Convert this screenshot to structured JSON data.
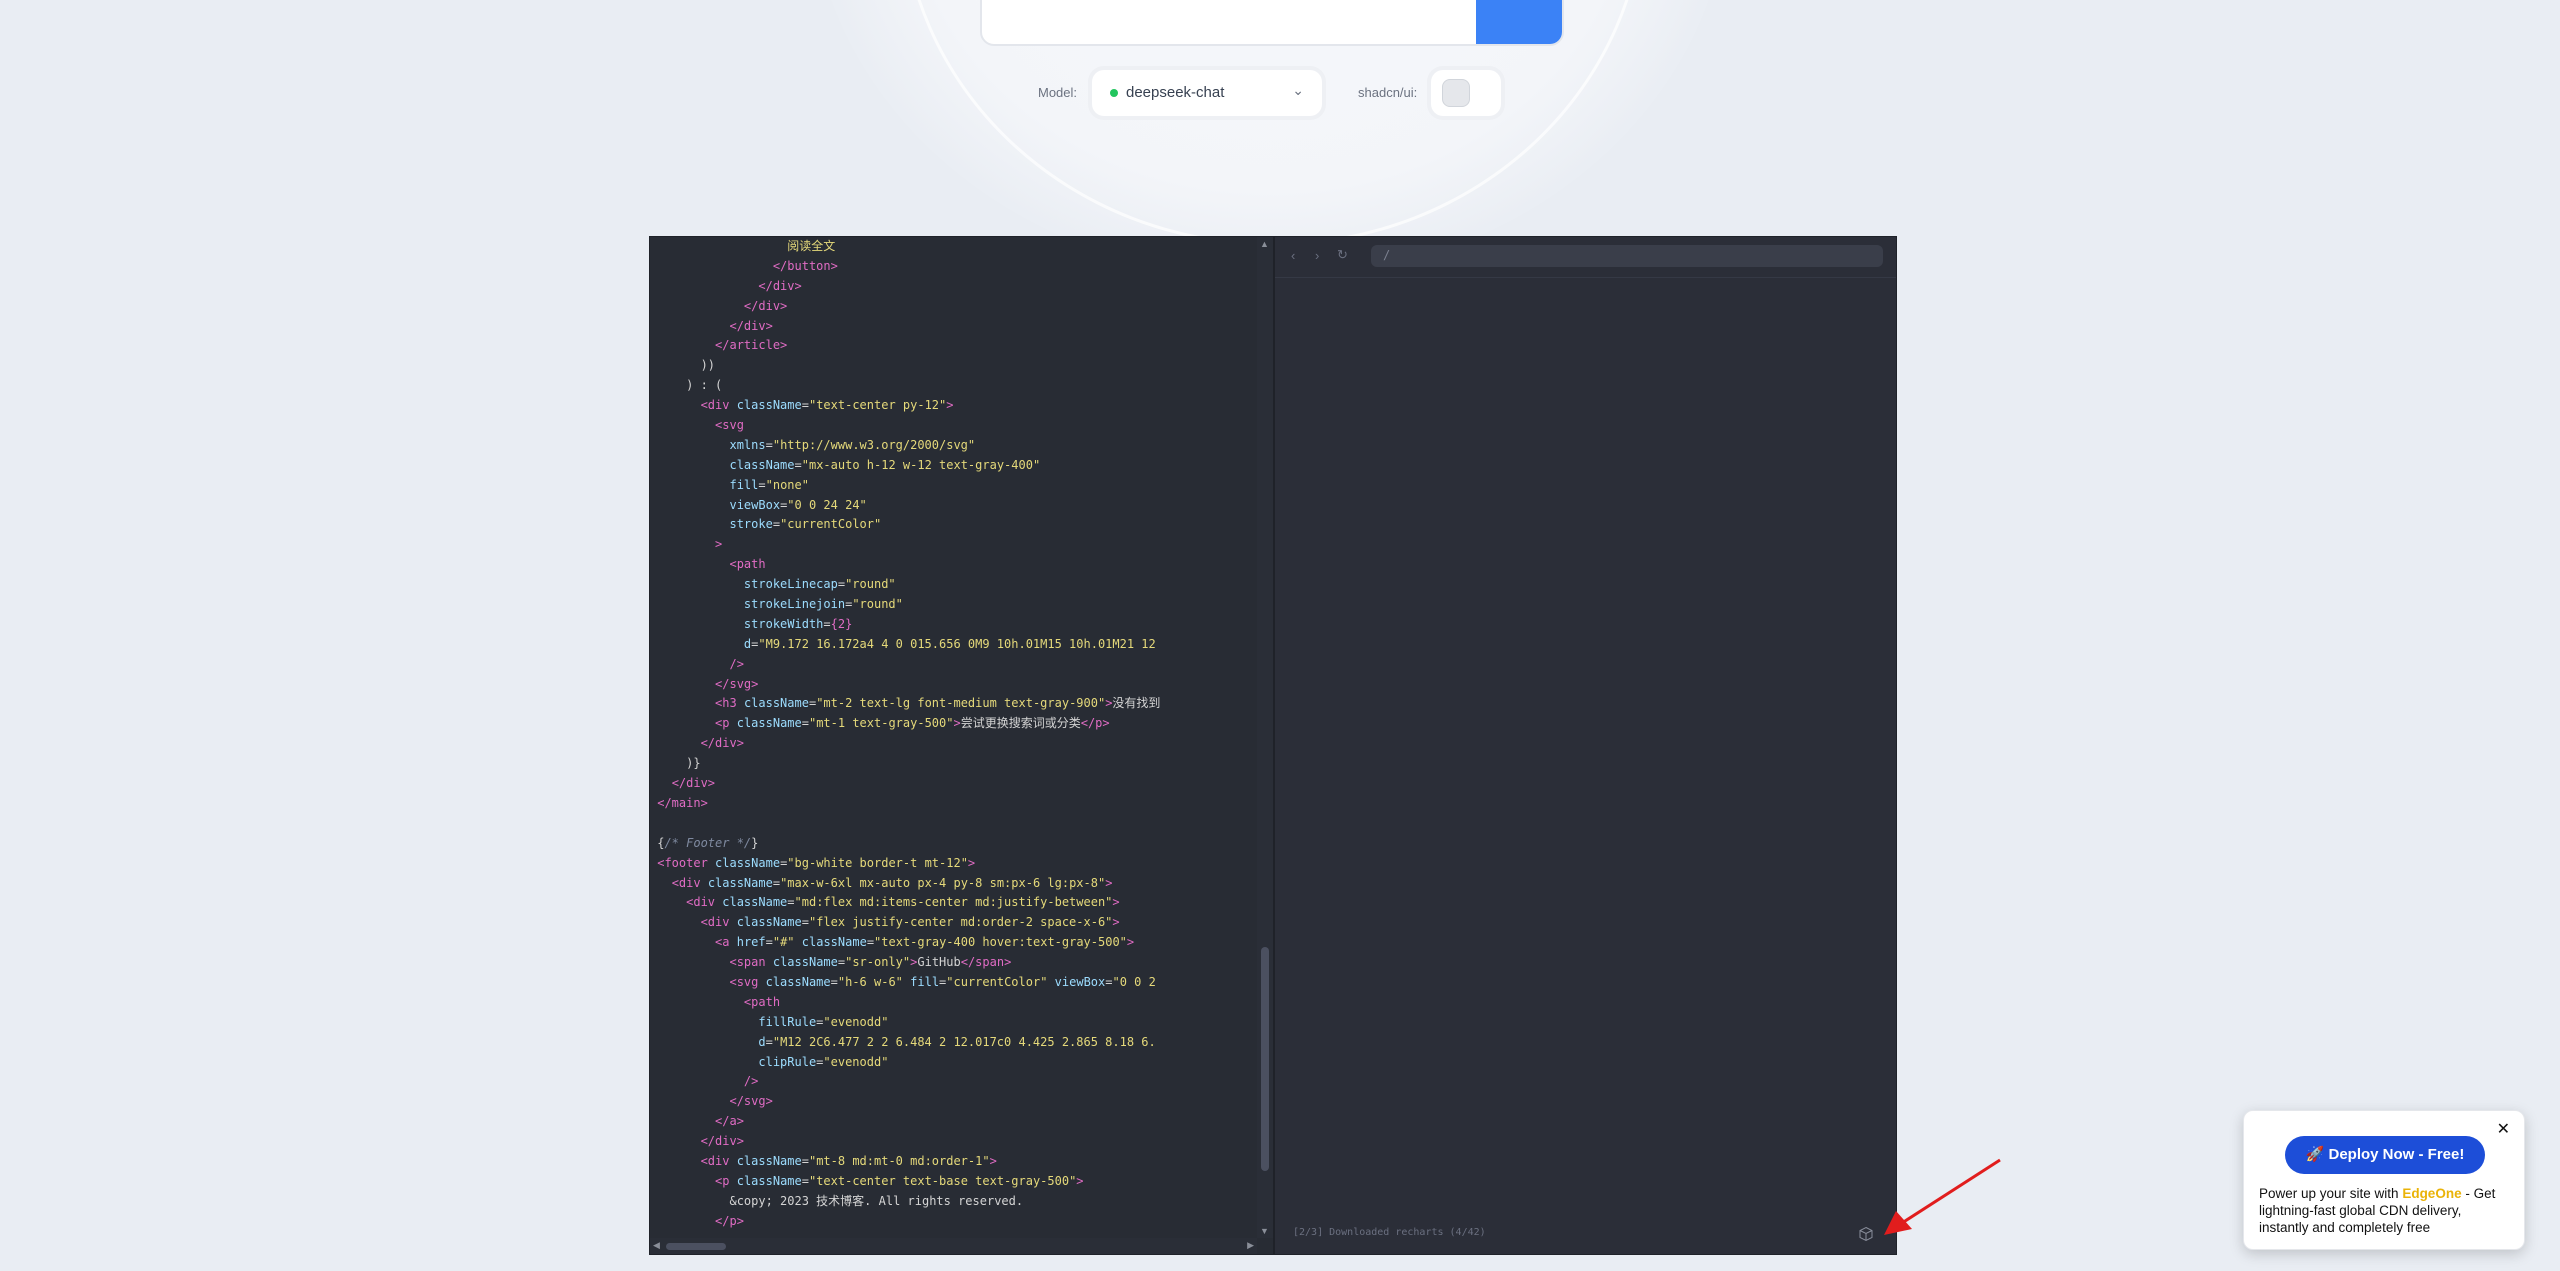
{
  "controls": {
    "model_label": "Model:",
    "model_value": "deepseek-chat",
    "shadcn_label": "shadcn/ui:"
  },
  "code_lines": [
    {
      "segs": [
        {
          "c": "s",
          "t": "                   阅读全文"
        }
      ]
    },
    {
      "segs": [
        {
          "c": "p",
          "t": "                 "
        },
        {
          "c": "t",
          "t": "</button>"
        }
      ]
    },
    {
      "segs": [
        {
          "c": "p",
          "t": "               "
        },
        {
          "c": "t",
          "t": "</div>"
        }
      ]
    },
    {
      "segs": [
        {
          "c": "p",
          "t": "             "
        },
        {
          "c": "t",
          "t": "</div>"
        }
      ]
    },
    {
      "segs": [
        {
          "c": "p",
          "t": "           "
        },
        {
          "c": "t",
          "t": "</div>"
        }
      ]
    },
    {
      "segs": [
        {
          "c": "p",
          "t": "         "
        },
        {
          "c": "t",
          "t": "</article>"
        }
      ]
    },
    {
      "segs": [
        {
          "c": "p",
          "t": "       ))"
        }
      ]
    },
    {
      "segs": [
        {
          "c": "p",
          "t": "     ) : ("
        }
      ]
    },
    {
      "segs": [
        {
          "c": "p",
          "t": "       "
        },
        {
          "c": "t",
          "t": "<div "
        },
        {
          "c": "a",
          "t": "className"
        },
        {
          "c": "p",
          "t": "="
        },
        {
          "c": "s",
          "t": "\"text-center py-12\""
        },
        {
          "c": "t",
          "t": ">"
        }
      ]
    },
    {
      "segs": [
        {
          "c": "p",
          "t": "         "
        },
        {
          "c": "t",
          "t": "<svg"
        }
      ]
    },
    {
      "segs": [
        {
          "c": "p",
          "t": "           "
        },
        {
          "c": "a",
          "t": "xmlns"
        },
        {
          "c": "p",
          "t": "="
        },
        {
          "c": "s",
          "t": "\"http://www.w3.org/2000/svg\""
        }
      ]
    },
    {
      "segs": [
        {
          "c": "p",
          "t": "           "
        },
        {
          "c": "a",
          "t": "className"
        },
        {
          "c": "p",
          "t": "="
        },
        {
          "c": "s",
          "t": "\"mx-auto h-12 w-12 text-gray-400\""
        }
      ]
    },
    {
      "segs": [
        {
          "c": "p",
          "t": "           "
        },
        {
          "c": "a",
          "t": "fill"
        },
        {
          "c": "p",
          "t": "="
        },
        {
          "c": "s",
          "t": "\"none\""
        }
      ]
    },
    {
      "segs": [
        {
          "c": "p",
          "t": "           "
        },
        {
          "c": "a",
          "t": "viewBox"
        },
        {
          "c": "p",
          "t": "="
        },
        {
          "c": "s",
          "t": "\"0 0 24 24\""
        }
      ]
    },
    {
      "segs": [
        {
          "c": "p",
          "t": "           "
        },
        {
          "c": "a",
          "t": "stroke"
        },
        {
          "c": "p",
          "t": "="
        },
        {
          "c": "s",
          "t": "\"currentColor\""
        }
      ]
    },
    {
      "segs": [
        {
          "c": "p",
          "t": "         "
        },
        {
          "c": "t",
          "t": ">"
        }
      ]
    },
    {
      "segs": [
        {
          "c": "p",
          "t": "           "
        },
        {
          "c": "t",
          "t": "<path"
        }
      ]
    },
    {
      "segs": [
        {
          "c": "p",
          "t": "             "
        },
        {
          "c": "a",
          "t": "strokeLinecap"
        },
        {
          "c": "p",
          "t": "="
        },
        {
          "c": "s",
          "t": "\"round\""
        }
      ]
    },
    {
      "segs": [
        {
          "c": "p",
          "t": "             "
        },
        {
          "c": "a",
          "t": "strokeLinejoin"
        },
        {
          "c": "p",
          "t": "="
        },
        {
          "c": "s",
          "t": "\"round\""
        }
      ]
    },
    {
      "segs": [
        {
          "c": "p",
          "t": "             "
        },
        {
          "c": "a",
          "t": "strokeWidth"
        },
        {
          "c": "p",
          "t": "="
        },
        {
          "c": "t",
          "t": "{2}"
        }
      ]
    },
    {
      "segs": [
        {
          "c": "p",
          "t": "             "
        },
        {
          "c": "a",
          "t": "d"
        },
        {
          "c": "p",
          "t": "="
        },
        {
          "c": "s",
          "t": "\"M9.172 16.172a4 4 0 015.656 0M9 10h.01M15 10h.01M21 12"
        }
      ]
    },
    {
      "segs": [
        {
          "c": "p",
          "t": "           "
        },
        {
          "c": "t",
          "t": "/>"
        }
      ]
    },
    {
      "segs": [
        {
          "c": "p",
          "t": "         "
        },
        {
          "c": "t",
          "t": "</svg>"
        }
      ]
    },
    {
      "segs": [
        {
          "c": "p",
          "t": "         "
        },
        {
          "c": "t",
          "t": "<h3 "
        },
        {
          "c": "a",
          "t": "className"
        },
        {
          "c": "p",
          "t": "="
        },
        {
          "c": "s",
          "t": "\"mt-2 text-lg font-medium text-gray-900\""
        },
        {
          "c": "t",
          "t": ">"
        },
        {
          "c": "p",
          "t": "没有找到"
        }
      ]
    },
    {
      "segs": [
        {
          "c": "p",
          "t": "         "
        },
        {
          "c": "t",
          "t": "<p "
        },
        {
          "c": "a",
          "t": "className"
        },
        {
          "c": "p",
          "t": "="
        },
        {
          "c": "s",
          "t": "\"mt-1 text-gray-500\""
        },
        {
          "c": "t",
          "t": ">"
        },
        {
          "c": "p",
          "t": "尝试更换搜索词或分类"
        },
        {
          "c": "t",
          "t": "</p>"
        }
      ]
    },
    {
      "segs": [
        {
          "c": "p",
          "t": "       "
        },
        {
          "c": "t",
          "t": "</div>"
        }
      ]
    },
    {
      "segs": [
        {
          "c": "p",
          "t": "     )}"
        }
      ]
    },
    {
      "segs": [
        {
          "c": "p",
          "t": "   "
        },
        {
          "c": "t",
          "t": "</div>"
        }
      ]
    },
    {
      "segs": [
        {
          "c": "p",
          "t": " "
        },
        {
          "c": "t",
          "t": "</main>"
        }
      ]
    },
    {
      "segs": [
        {
          "c": "p",
          "t": ""
        }
      ]
    },
    {
      "segs": [
        {
          "c": "p",
          "t": " {"
        },
        {
          "c": "c",
          "t": "/* Footer */"
        },
        {
          "c": "p",
          "t": "}"
        }
      ]
    },
    {
      "segs": [
        {
          "c": "p",
          "t": " "
        },
        {
          "c": "t",
          "t": "<footer "
        },
        {
          "c": "a",
          "t": "className"
        },
        {
          "c": "p",
          "t": "="
        },
        {
          "c": "s",
          "t": "\"bg-white border-t mt-12\""
        },
        {
          "c": "t",
          "t": ">"
        }
      ]
    },
    {
      "segs": [
        {
          "c": "p",
          "t": "   "
        },
        {
          "c": "t",
          "t": "<div "
        },
        {
          "c": "a",
          "t": "className"
        },
        {
          "c": "p",
          "t": "="
        },
        {
          "c": "s",
          "t": "\"max-w-6xl mx-auto px-4 py-8 sm:px-6 lg:px-8\""
        },
        {
          "c": "t",
          "t": ">"
        }
      ]
    },
    {
      "segs": [
        {
          "c": "p",
          "t": "     "
        },
        {
          "c": "t",
          "t": "<div "
        },
        {
          "c": "a",
          "t": "className"
        },
        {
          "c": "p",
          "t": "="
        },
        {
          "c": "s",
          "t": "\"md:flex md:items-center md:justify-between\""
        },
        {
          "c": "t",
          "t": ">"
        }
      ]
    },
    {
      "segs": [
        {
          "c": "p",
          "t": "       "
        },
        {
          "c": "t",
          "t": "<div "
        },
        {
          "c": "a",
          "t": "className"
        },
        {
          "c": "p",
          "t": "="
        },
        {
          "c": "s",
          "t": "\"flex justify-center md:order-2 space-x-6\""
        },
        {
          "c": "t",
          "t": ">"
        }
      ]
    },
    {
      "segs": [
        {
          "c": "p",
          "t": "         "
        },
        {
          "c": "t",
          "t": "<a "
        },
        {
          "c": "a",
          "t": "href"
        },
        {
          "c": "p",
          "t": "="
        },
        {
          "c": "s",
          "t": "\"#\""
        },
        {
          "c": "p",
          "t": " "
        },
        {
          "c": "a",
          "t": "className"
        },
        {
          "c": "p",
          "t": "="
        },
        {
          "c": "s",
          "t": "\"text-gray-400 hover:text-gray-500\""
        },
        {
          "c": "t",
          "t": ">"
        }
      ]
    },
    {
      "segs": [
        {
          "c": "p",
          "t": "           "
        },
        {
          "c": "t",
          "t": "<span "
        },
        {
          "c": "a",
          "t": "className"
        },
        {
          "c": "p",
          "t": "="
        },
        {
          "c": "s",
          "t": "\"sr-only\""
        },
        {
          "c": "t",
          "t": ">"
        },
        {
          "c": "p",
          "t": "GitHub"
        },
        {
          "c": "t",
          "t": "</span>"
        }
      ]
    },
    {
      "segs": [
        {
          "c": "p",
          "t": "           "
        },
        {
          "c": "t",
          "t": "<svg "
        },
        {
          "c": "a",
          "t": "className"
        },
        {
          "c": "p",
          "t": "="
        },
        {
          "c": "s",
          "t": "\"h-6 w-6\""
        },
        {
          "c": "p",
          "t": " "
        },
        {
          "c": "a",
          "t": "fill"
        },
        {
          "c": "p",
          "t": "="
        },
        {
          "c": "s",
          "t": "\"currentColor\""
        },
        {
          "c": "p",
          "t": " "
        },
        {
          "c": "a",
          "t": "viewBox"
        },
        {
          "c": "p",
          "t": "="
        },
        {
          "c": "s",
          "t": "\"0 0 2"
        }
      ]
    },
    {
      "segs": [
        {
          "c": "p",
          "t": "             "
        },
        {
          "c": "t",
          "t": "<path"
        }
      ]
    },
    {
      "segs": [
        {
          "c": "p",
          "t": "               "
        },
        {
          "c": "a",
          "t": "fillRule"
        },
        {
          "c": "p",
          "t": "="
        },
        {
          "c": "s",
          "t": "\"evenodd\""
        }
      ]
    },
    {
      "segs": [
        {
          "c": "p",
          "t": "               "
        },
        {
          "c": "a",
          "t": "d"
        },
        {
          "c": "p",
          "t": "="
        },
        {
          "c": "s",
          "t": "\"M12 2C6.477 2 2 6.484 2 12.017c0 4.425 2.865 8.18 6."
        }
      ]
    },
    {
      "segs": [
        {
          "c": "p",
          "t": "               "
        },
        {
          "c": "a",
          "t": "clipRule"
        },
        {
          "c": "p",
          "t": "="
        },
        {
          "c": "s",
          "t": "\"evenodd\""
        }
      ]
    },
    {
      "segs": [
        {
          "c": "p",
          "t": "             "
        },
        {
          "c": "t",
          "t": "/>"
        }
      ]
    },
    {
      "segs": [
        {
          "c": "p",
          "t": "           "
        },
        {
          "c": "t",
          "t": "</svg>"
        }
      ]
    },
    {
      "segs": [
        {
          "c": "p",
          "t": "         "
        },
        {
          "c": "t",
          "t": "</a>"
        }
      ]
    },
    {
      "segs": [
        {
          "c": "p",
          "t": "       "
        },
        {
          "c": "t",
          "t": "</div>"
        }
      ]
    },
    {
      "segs": [
        {
          "c": "p",
          "t": "       "
        },
        {
          "c": "t",
          "t": "<div "
        },
        {
          "c": "a",
          "t": "className"
        },
        {
          "c": "p",
          "t": "="
        },
        {
          "c": "s",
          "t": "\"mt-8 md:mt-0 md:order-1\""
        },
        {
          "c": "t",
          "t": ">"
        }
      ]
    },
    {
      "segs": [
        {
          "c": "p",
          "t": "         "
        },
        {
          "c": "t",
          "t": "<p "
        },
        {
          "c": "a",
          "t": "className"
        },
        {
          "c": "p",
          "t": "="
        },
        {
          "c": "s",
          "t": "\"text-center text-base text-gray-500\""
        },
        {
          "c": "t",
          "t": ">"
        }
      ]
    },
    {
      "segs": [
        {
          "c": "p",
          "t": "           &copy; 2023 技术博客. All rights reserved."
        }
      ]
    },
    {
      "segs": [
        {
          "c": "p",
          "t": "         "
        },
        {
          "c": "t",
          "t": "</p>"
        }
      ]
    }
  ],
  "preview": {
    "url": "/",
    "status": "[2/3] Downloaded recharts (4/42)"
  },
  "toast": {
    "deploy_label": "🚀 Deploy Now - Free!",
    "desc_before": "Power up your site with ",
    "desc_brand": "EdgeOne",
    "desc_after": " - Get lightning-fast global CDN delivery, instantly and completely free",
    "close": "✕"
  },
  "colors": {
    "accent": "#3b82f6",
    "deploy": "#1d4ed8",
    "editor_bg": "#282c34",
    "arrow": "#e11d1d"
  }
}
